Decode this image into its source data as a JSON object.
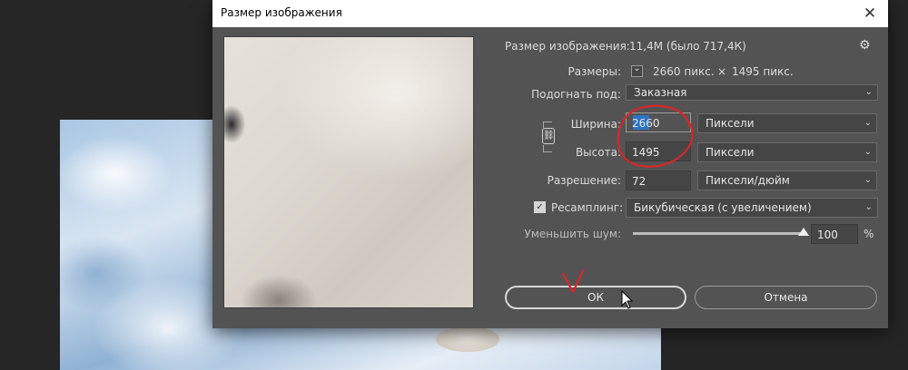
{
  "dialog": {
    "title": "Размер изображения",
    "close_glyph": "✕",
    "gear_glyph": "⚙",
    "image_size_label": "Размер изображения:",
    "image_size_value": "11,4М (было 717,4К)",
    "dimensions_label": "Размеры:",
    "dimensions_chevron": "⌵",
    "width_px": "2660 пикс.",
    "times": "×",
    "height_px": "1495 пикс.",
    "fit_label": "Подогнать под:",
    "fit_value": "Заказная",
    "width_label": "Ширина:",
    "width_value": "2660",
    "width_unit": "Пиксели",
    "height_label": "Высота:",
    "height_value": "1495",
    "height_unit": "Пиксели",
    "resolution_label": "Разрешение:",
    "resolution_value": "72",
    "resolution_unit": "Пиксели/дюйм",
    "resample_label": "Ресамплинг:",
    "resample_checked": true,
    "resample_value": "Бикубическая (с увеличением)",
    "noise_label": "Уменьшить шум:",
    "noise_value": "100",
    "noise_unit": "%",
    "noise_level": 1.0,
    "ok_label": "ОК",
    "cancel_label": "Отмена",
    "chevron": "⌄",
    "check_glyph": "✓",
    "link_glyph": "⛓"
  },
  "colors": {
    "dialog_bg": "#535353",
    "field_bg": "#454545",
    "text": "#dcdcdc",
    "annotation_red": "#d4282a",
    "selection_blue": "#2d72c4"
  }
}
